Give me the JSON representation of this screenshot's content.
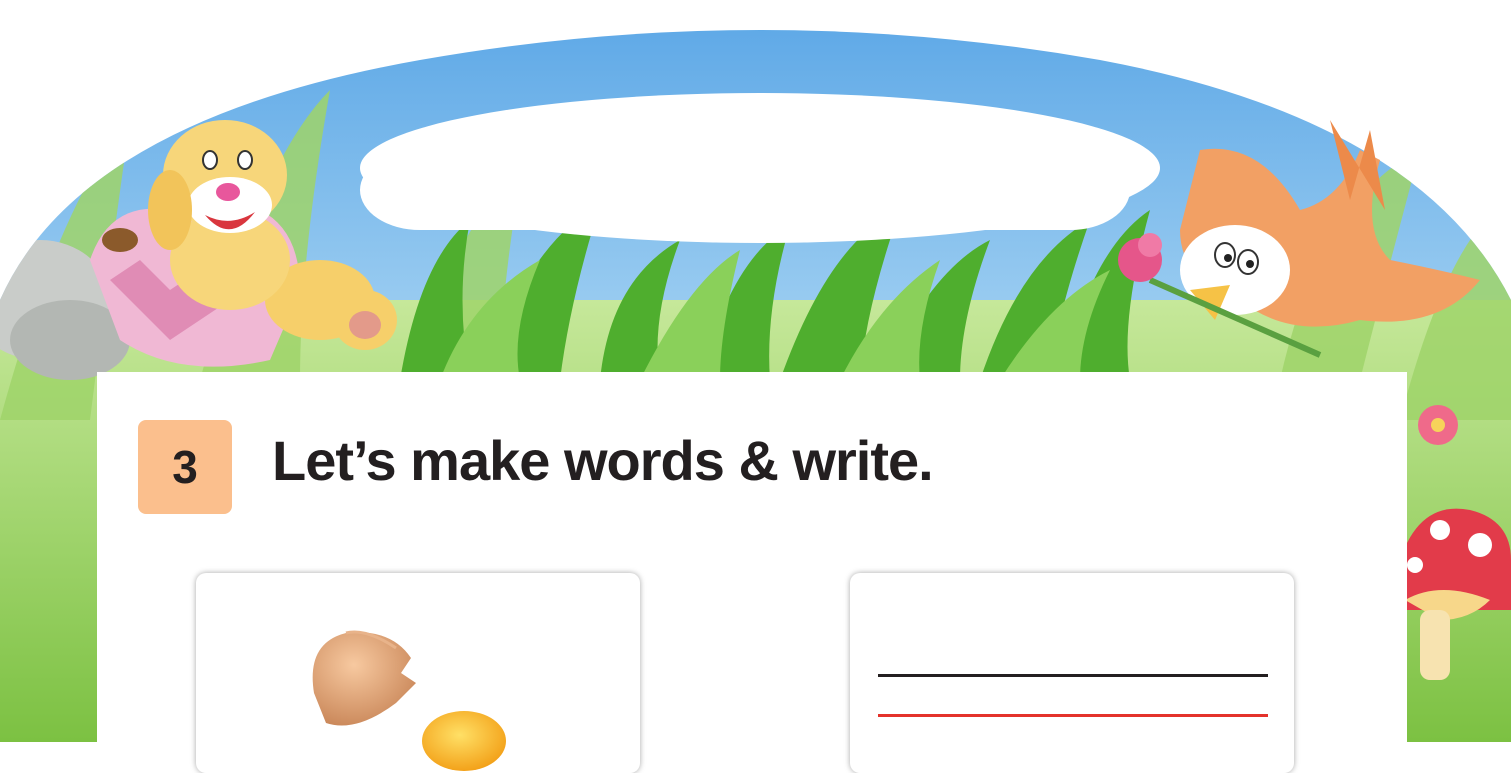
{
  "exercise": {
    "number": "3",
    "title": "Let’s make words & write."
  },
  "colors": {
    "sky": "#8cc4ee",
    "grass": "#7cc142",
    "number_badge": "#fbbf8d",
    "write_line_top": "#231f20",
    "write_line_bottom": "#e4322b"
  },
  "illustrations": {
    "left_character": "dog-on-pillow",
    "right_character": "bird-with-flower",
    "card_image": "cracked-egg"
  }
}
